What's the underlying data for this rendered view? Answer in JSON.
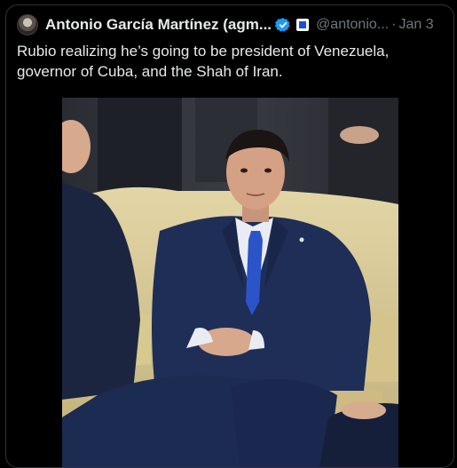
{
  "tweet": {
    "author_name": "Antonio García Martínez (agm...",
    "handle": "@antonio...",
    "separator": "·",
    "date": "Jan 3",
    "text": "Rubio realizing he’s going to be president of Venezuela, governor of Cuba, and the Shah of Iran."
  },
  "icons": {
    "avatar": "profile-avatar",
    "verified": "verified-checkmark-icon",
    "affiliation": "affiliation-badge-icon"
  },
  "colors": {
    "background": "#000000",
    "text": "#e7e9ea",
    "muted": "#71767b",
    "verified": "#1d9bf0",
    "border": "#2f3336"
  }
}
